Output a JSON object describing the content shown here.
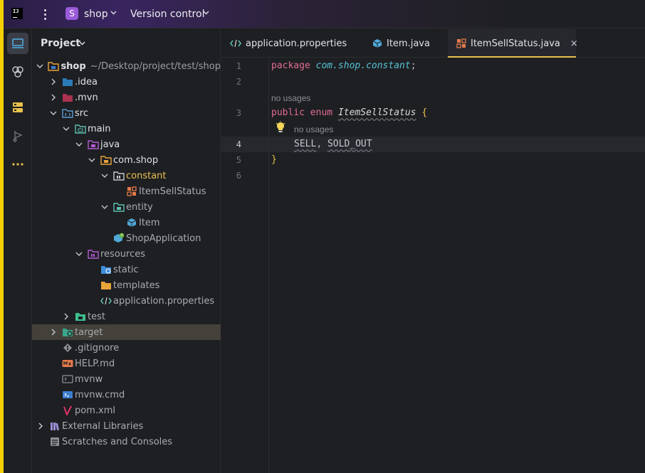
{
  "titlebar": {
    "project_badge": "S",
    "project_name": "shop",
    "vcs_label": "Version control"
  },
  "toolstrip": {
    "items": [
      {
        "icon": "project-view-icon",
        "active": true
      },
      {
        "icon": "ai-assistant-icon"
      },
      {
        "icon": "database-icon"
      },
      {
        "icon": "run-debug-icon"
      },
      {
        "icon": "more-tools-icon"
      }
    ]
  },
  "project_panel": {
    "title": "Project",
    "tree": [
      {
        "label": "shop",
        "path": "~/Desktop/project/test/shop"
      },
      {
        "label": ".idea"
      },
      {
        "label": ".mvn"
      },
      {
        "label": "src"
      },
      {
        "label": "main"
      },
      {
        "label": "java"
      },
      {
        "label": "com.shop"
      },
      {
        "label": "constant"
      },
      {
        "label": "ItemSellStatus"
      },
      {
        "label": "entity"
      },
      {
        "label": "Item"
      },
      {
        "label": "ShopApplication"
      },
      {
        "label": "resources"
      },
      {
        "label": "static"
      },
      {
        "label": "templates"
      },
      {
        "label": "application.properties"
      },
      {
        "label": "test"
      },
      {
        "label": "target"
      },
      {
        "label": ".gitignore"
      },
      {
        "label": "HELP.md"
      },
      {
        "label": "mvnw"
      },
      {
        "label": "mvnw.cmd"
      },
      {
        "label": "pom.xml"
      },
      {
        "label": "External Libraries"
      },
      {
        "label": "Scratches and Consoles"
      }
    ]
  },
  "tabs": [
    {
      "label": "application.properties"
    },
    {
      "label": "Item.java"
    },
    {
      "label": "ItemSellStatus.java",
      "active": true,
      "close": "×"
    }
  ],
  "editor": {
    "line_numbers": [
      "1",
      "2",
      "3",
      "4",
      "5",
      "6"
    ],
    "current_line": "4",
    "hints": [
      "no usages",
      "no usages"
    ],
    "line1": {
      "kw": "package",
      "pkg": "com.shop.constant",
      "end": ";"
    },
    "line3": {
      "kw1": "public",
      "kw2": "enum",
      "name": "ItemSellStatus",
      "brace": "{"
    },
    "line4": {
      "c1": "SELL",
      "sep": ",",
      "c2": "SOLD_OUT"
    },
    "line5": {
      "brace": "}"
    }
  },
  "colors": {
    "accent_yellow": "#f5d000",
    "tab_underline": "#e8c14e",
    "keyword": "#cf8e6d",
    "package": "#56c3d8"
  }
}
